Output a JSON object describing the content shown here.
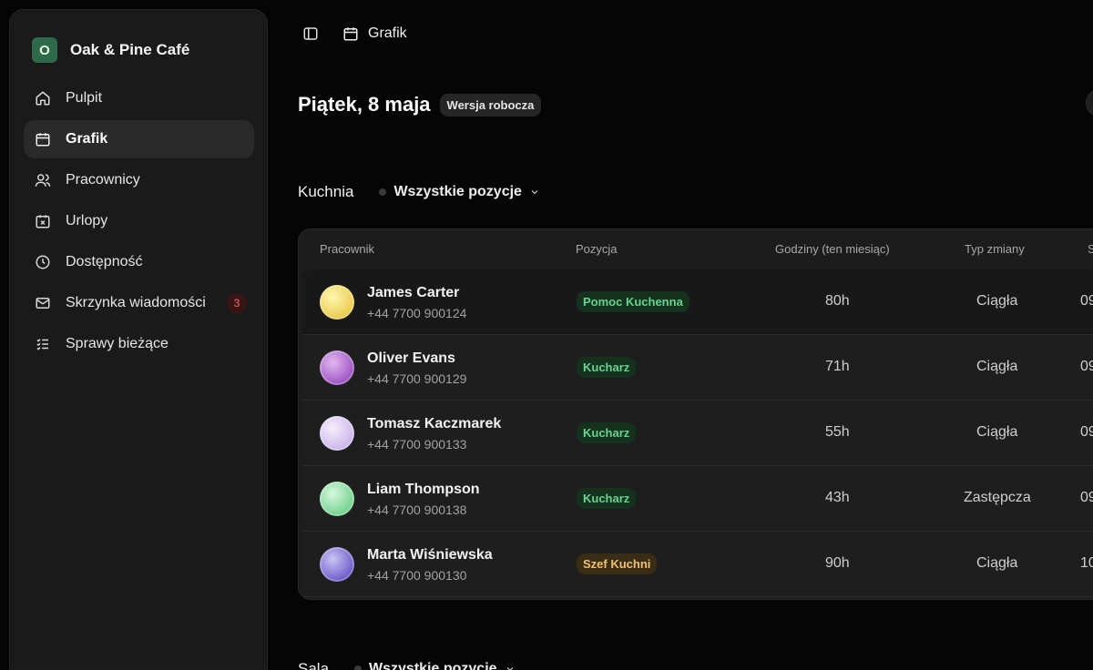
{
  "brand": {
    "logo_letter": "O",
    "name": "Oak & Pine Café",
    "color": "#2d6a4a"
  },
  "sidebar": {
    "items": [
      {
        "label": "Pulpit",
        "icon": "home-icon"
      },
      {
        "label": "Grafik",
        "icon": "calendar-icon",
        "active": true
      },
      {
        "label": "Pracownicy",
        "icon": "users-icon"
      },
      {
        "label": "Urlopy",
        "icon": "calendar-x-icon"
      },
      {
        "label": "Dostępność",
        "icon": "clock-icon"
      },
      {
        "label": "Skrzynka wiadomości",
        "icon": "mail-icon",
        "badge": "3"
      },
      {
        "label": "Sprawy bieżące",
        "icon": "checklist-icon"
      }
    ]
  },
  "topbar": {
    "breadcrumb": "Grafik"
  },
  "page": {
    "title": "Piątek, 8 maja",
    "status_badge": "Wersja robocza"
  },
  "kitchen": {
    "title": "Kuchnia",
    "filter": "Wszystkie pozycje",
    "columns": [
      "Pracownik",
      "Pozycja",
      "Godziny (ten miesiąc)",
      "Typ zmiany",
      "S"
    ],
    "rows": [
      {
        "name": "James Carter",
        "phone": "+44 7700 900124",
        "position": "Pomoc Kuchenna",
        "position_color": "green",
        "hours": "80h",
        "shift": "Ciągła",
        "start": "09",
        "avatar": [
          "#fff6b0",
          "#e8c94a"
        ]
      },
      {
        "name": "Oliver Evans",
        "phone": "+44 7700 900129",
        "position": "Kucharz",
        "position_color": "green",
        "hours": "71h",
        "shift": "Ciągła",
        "start": "09",
        "avatar": [
          "#e2b8f0",
          "#9b4fc0"
        ]
      },
      {
        "name": "Tomasz Kaczmarek",
        "phone": "+44 7700 900133",
        "position": "Kucharz",
        "position_color": "green",
        "hours": "55h",
        "shift": "Ciągła",
        "start": "09",
        "avatar": [
          "#f6eefc",
          "#c9b4ea"
        ]
      },
      {
        "name": "Liam Thompson",
        "phone": "+44 7700 900138",
        "position": "Kucharz",
        "position_color": "green",
        "hours": "43h",
        "shift": "Zastępcza",
        "start": "09",
        "avatar": [
          "#d8f7df",
          "#6dd08a"
        ]
      },
      {
        "name": "Marta Wiśniewska",
        "phone": "+44 7700 900130",
        "position": "Szef Kuchni",
        "position_color": "amber",
        "hours": "90h",
        "shift": "Ciągła",
        "start": "10",
        "avatar": [
          "#c9c4f4",
          "#6a58c8"
        ]
      }
    ]
  },
  "sala": {
    "title": "Sala",
    "filter": "Wszystkie pozycje"
  }
}
